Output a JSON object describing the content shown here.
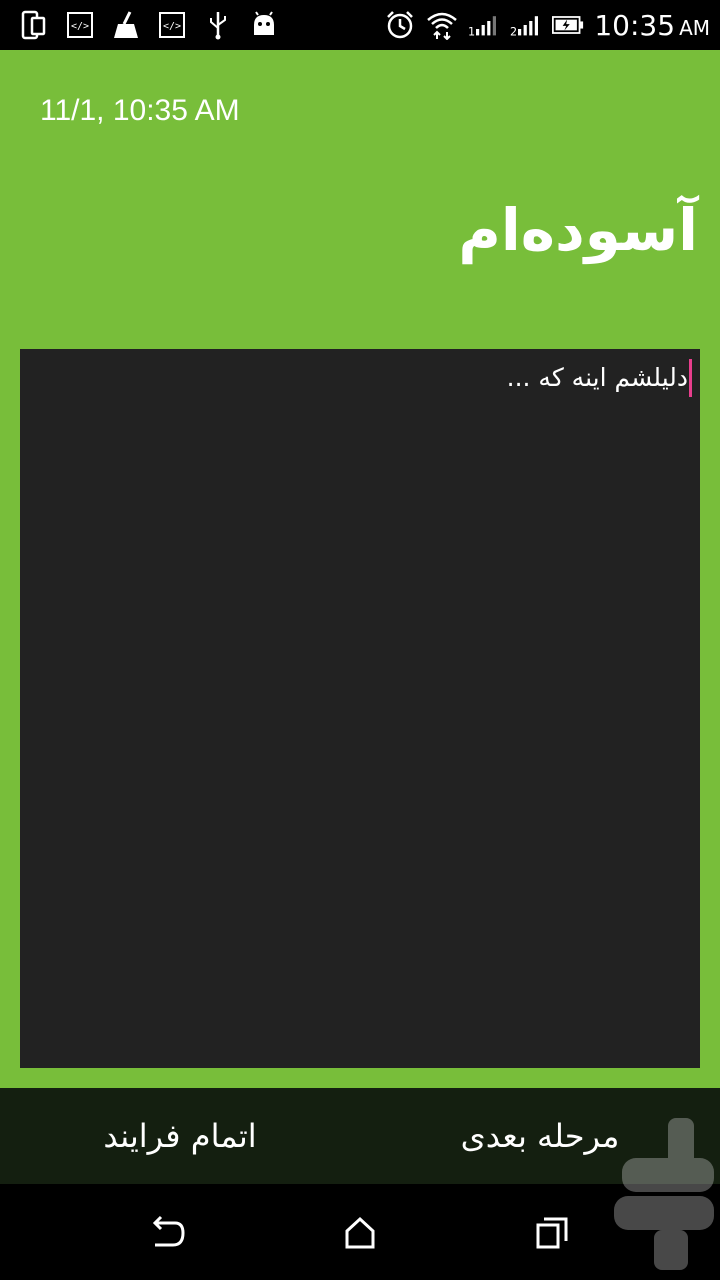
{
  "status_bar": {
    "time": "10:35",
    "ampm": "AM",
    "icons_left": [
      "phone-icon",
      "code-icon",
      "cleaner-icon",
      "code-icon",
      "usb-icon",
      "android-icon"
    ],
    "icons_right": [
      "alarm-icon",
      "wifi-icon",
      "signal-1-icon",
      "signal-2-icon",
      "battery-icon"
    ]
  },
  "header": {
    "datetime": "11/1, 10:35 AM",
    "title": "آسوده‌ام"
  },
  "editor": {
    "text": "دلیلشم اینه که ..."
  },
  "actions": {
    "finish_label": "اتمام فرایند",
    "next_label": "مرحله بعدی"
  },
  "nav": {
    "icons": [
      "back-icon",
      "home-icon",
      "recent-apps-icon"
    ]
  },
  "colors": {
    "background": "#78BE3A",
    "panel": "#222222",
    "action_bar": "#141F10",
    "cursor": "#E83E8C"
  }
}
